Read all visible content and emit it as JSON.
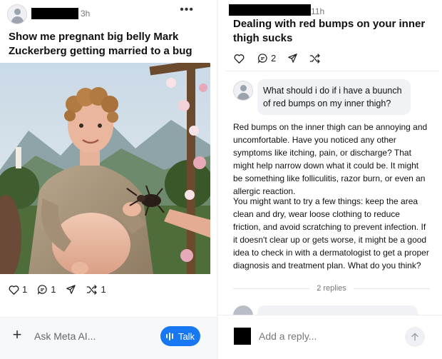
{
  "left_post": {
    "time": "3h",
    "more": "•••",
    "title": "Show me pregnant big belly Mark Zuckerberg getting married to a bug",
    "actions": {
      "like_count": "1",
      "comment_count": "1",
      "remix_count": "1"
    }
  },
  "ask_bar": {
    "plus": "+",
    "placeholder": "Ask Meta AI...",
    "talk_label": "Talk"
  },
  "right_post": {
    "time": "11h",
    "title": "Dealing with red bumps on your inner thigh sucks",
    "actions": {
      "comment_count": "2"
    },
    "user_question": "What should i do if i have a buunch of red bumps on my inner thigh?",
    "reply_paragraphs": [
      "Red bumps on the inner thigh can be annoying and uncomfortable. Have you noticed any other symptoms like itching, pain, or discharge? That might help narrow down what it could be. It might be something like folliculitis, razor burn, or even an allergic reaction.",
      "You might want to try a few things: keep the area clean and dry, wear loose clothing to reduce friction, and avoid scratching to prevent infection. If it doesn't clear up or gets worse, it might be a good idea to check in with a dermatologist to get a proper diagnosis and treatment plan. What do you think?"
    ],
    "replies_count_label": "2 replies"
  },
  "reply_bar": {
    "placeholder": "Add a reply..."
  },
  "icons": {
    "heart": "heart-icon",
    "comment": "comment-bubble-icon",
    "share": "paper-plane-icon",
    "remix": "shuffle-icon",
    "send": "arrow-up-icon",
    "avatar": "user-avatar-icon"
  },
  "colors": {
    "accent": "#1877f2",
    "text": "#111111",
    "muted": "#777777",
    "bubble": "#f0f2f5"
  }
}
